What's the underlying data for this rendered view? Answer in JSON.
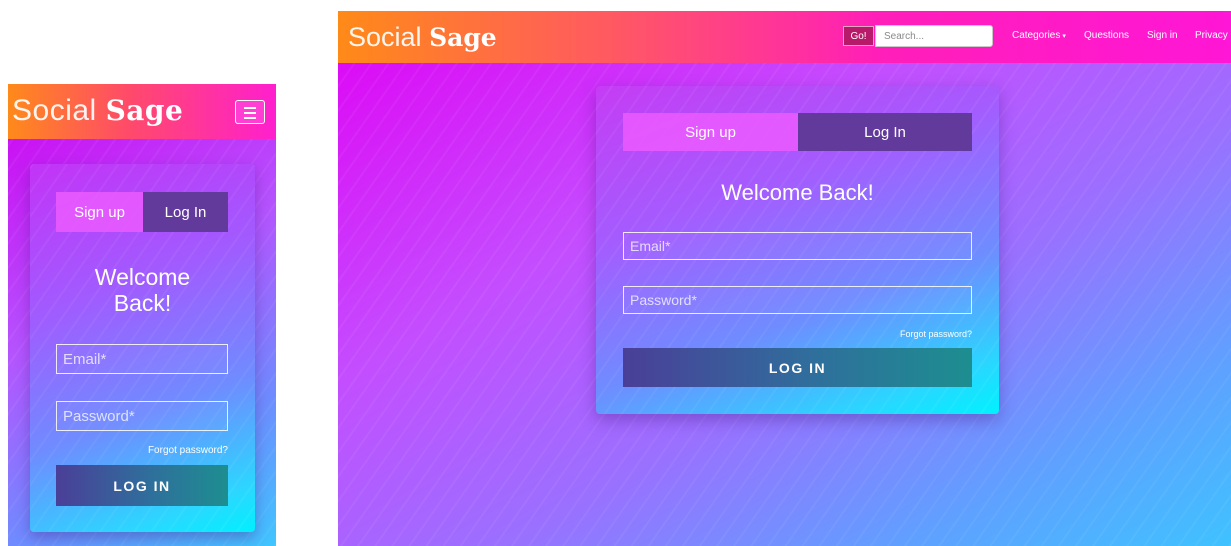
{
  "brand": {
    "light": "Social",
    "bold": "Sage"
  },
  "colors": {
    "header_orange": "#ff8a1a",
    "header_magenta": "#ff1fcf",
    "background_purple": "#c44dff",
    "background_cyan": "#3fc2ff",
    "tab_signup": "#eb5aff",
    "tab_login": "#613a9c",
    "login_button": "#2f6f9c"
  },
  "mobile": {
    "menu_icon": "hamburger-icon",
    "card": {
      "tabs": {
        "signup": "Sign up",
        "login": "Log In"
      },
      "welcome_line1": "Welcome",
      "welcome_line2": "Back!",
      "email_placeholder": "Email*",
      "password_placeholder": "Password*",
      "forgot": "Forgot password?",
      "login_button": "LOG IN"
    }
  },
  "desktop": {
    "nav": {
      "go_button": "Go!",
      "search_placeholder": "Search...",
      "categories": "Categories",
      "categories_caret": "▾",
      "questions": "Questions",
      "sign_in": "Sign in",
      "privacy": "Privacy"
    },
    "card": {
      "tabs": {
        "signup": "Sign up",
        "login": "Log In"
      },
      "welcome": "Welcome Back!",
      "email_placeholder": "Email*",
      "password_placeholder": "Password*",
      "forgot": "Forgot password?",
      "login_button": "LOG IN"
    }
  }
}
